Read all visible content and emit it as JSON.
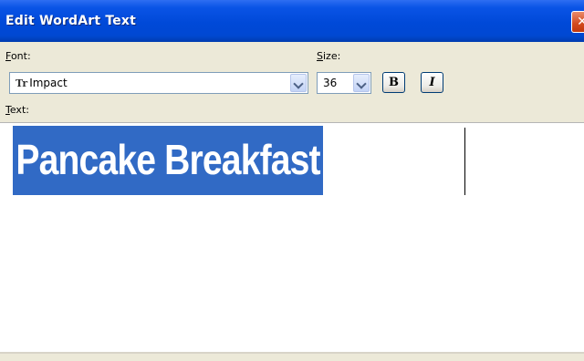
{
  "window": {
    "title": "Edit WordArt Text",
    "close_glyph": "✕"
  },
  "font": {
    "label_accel": "F",
    "label_rest": "ont:",
    "value": "Impact",
    "glyph": "Tr"
  },
  "size": {
    "label_accel": "S",
    "label_rest": "ize:",
    "value": "36"
  },
  "format": {
    "bold_label": "B",
    "italic_label": "I"
  },
  "text": {
    "label_accel": "T",
    "label_rest": "ext:",
    "content": "Pancake Breakfast"
  },
  "colors": {
    "title_bar": "#0048d2",
    "selection": "#316ac5",
    "dialog_bg": "#ece9d8"
  }
}
